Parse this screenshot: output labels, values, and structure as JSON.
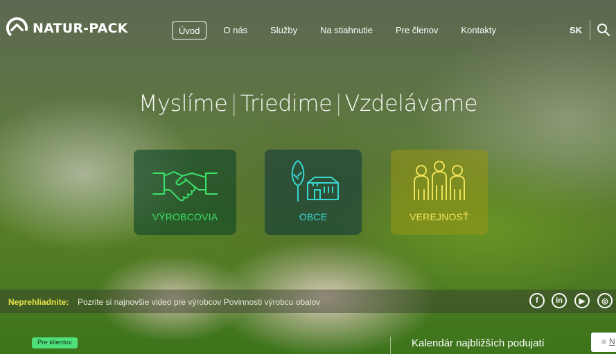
{
  "header": {
    "logo_text": "NATUR-PACK",
    "nav": [
      "Úvod",
      "O nás",
      "Služby",
      "Na stiahnutie",
      "Pre členov",
      "Kontakty"
    ],
    "active_nav": "Úvod",
    "lang": "SK",
    "search_icon": "search-icon"
  },
  "hero": {
    "tagline": [
      "Myslíme",
      "Triedime",
      "Vzdelávame"
    ],
    "cards": [
      {
        "label": "VÝROBCOVIA",
        "icon": "handshake-icon",
        "color": "#3de26b"
      },
      {
        "label": "OBCE",
        "icon": "tree-house-icon",
        "color": "#37d9d4"
      },
      {
        "label": "VEREJNOSŤ",
        "icon": "people-icon",
        "color": "#f0e35a"
      }
    ]
  },
  "notice": {
    "label": "Neprehliadnite:",
    "text": "Pozrite si najnovšie video pre výrobcov Povinnosti výrobcu obalov"
  },
  "social": [
    "facebook-icon",
    "linkedin-icon",
    "youtube-icon",
    "instagram-icon"
  ],
  "bottom": {
    "badge": "Pre klientov",
    "calendar_title": "Kalendár najbližších podujatí",
    "input_partial": "N"
  }
}
